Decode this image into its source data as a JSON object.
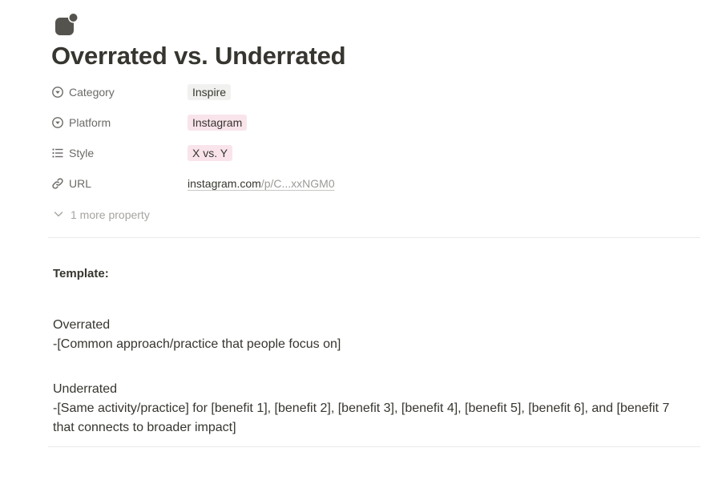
{
  "page": {
    "title": "Overrated vs. Underrated",
    "icon": "shapes-icon"
  },
  "properties": [
    {
      "icon": "select-icon",
      "label": "Category",
      "value": "Inspire",
      "tag_color": "#f1f1ef"
    },
    {
      "icon": "select-icon",
      "label": "Platform",
      "value": "Instagram",
      "tag_color": "#f9e4ec"
    },
    {
      "icon": "list-icon",
      "label": "Style",
      "value": "X vs. Y",
      "tag_color": "#f9e4ec"
    },
    {
      "icon": "link-icon",
      "label": "URL",
      "url_main": "instagram.com",
      "url_rest": "/p/C...xxNGM0"
    }
  ],
  "more_properties": "1 more property",
  "content": {
    "template_heading": "Template:",
    "overrated_heading": "Overrated",
    "overrated_line": "-[Common approach/practice that people focus on]",
    "underrated_heading": "Underrated",
    "underrated_line_1": "-[Same activity/practice] for [benefit 1], [benefit 2], [benefit 3], [benefit 4], [benefit 5], [benefit 6], and [benefit 7",
    "underrated_line_2": "that connects to broader impact]"
  },
  "colors": {
    "text": "#37352f",
    "muted": "#6b6a66",
    "icon": "#55534e"
  }
}
